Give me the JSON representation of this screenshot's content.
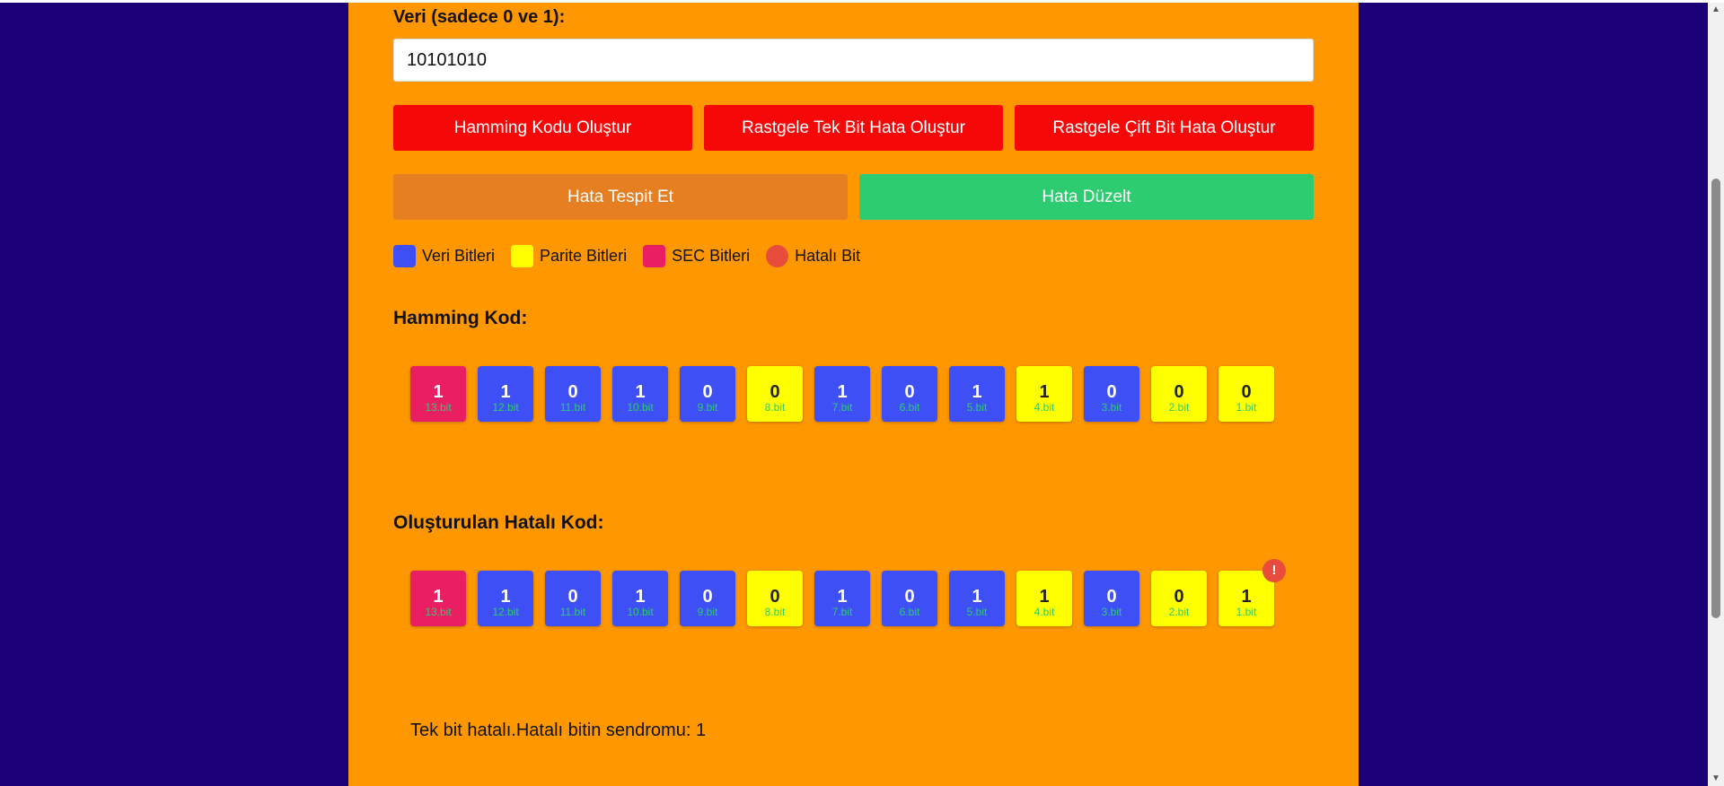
{
  "form": {
    "label": "Veri (sadece 0 ve 1):",
    "input_value": "10101010"
  },
  "buttons": {
    "generate": "Hamming Kodu Oluştur",
    "single_error": "Rastgele Tek Bit Hata Oluştur",
    "double_error": "Rastgele Çift Bit Hata Oluştur",
    "detect": "Hata Tespit Et",
    "correct": "Hata Düzelt"
  },
  "legend": {
    "data_bits": "Veri Bitleri",
    "parity_bits": "Parite Bitleri",
    "sec_bits": "SEC Bitleri",
    "error_bit": "Hatalı Bit"
  },
  "colors": {
    "data": "#3d4ff5",
    "parity": "#ffff00",
    "sec": "#e91e63",
    "error": "#e74c3c",
    "position_text": "#2ecc71",
    "panel": "#ff9800",
    "background": "#1b0078",
    "button_red": "#f60808",
    "button_orange": "#e67e22",
    "button_green": "#2ecc71"
  },
  "hamming": {
    "title": "Hamming Kod:",
    "bits": [
      {
        "value": "1",
        "pos": "13.bit",
        "type": "sec"
      },
      {
        "value": "1",
        "pos": "12.bit",
        "type": "data"
      },
      {
        "value": "0",
        "pos": "11.bit",
        "type": "data"
      },
      {
        "value": "1",
        "pos": "10.bit",
        "type": "data"
      },
      {
        "value": "0",
        "pos": "9.bit",
        "type": "data"
      },
      {
        "value": "0",
        "pos": "8.bit",
        "type": "parity"
      },
      {
        "value": "1",
        "pos": "7.bit",
        "type": "data"
      },
      {
        "value": "0",
        "pos": "6.bit",
        "type": "data"
      },
      {
        "value": "1",
        "pos": "5.bit",
        "type": "data"
      },
      {
        "value": "1",
        "pos": "4.bit",
        "type": "parity"
      },
      {
        "value": "0",
        "pos": "3.bit",
        "type": "data"
      },
      {
        "value": "0",
        "pos": "2.bit",
        "type": "parity"
      },
      {
        "value": "0",
        "pos": "1.bit",
        "type": "parity"
      }
    ]
  },
  "error_code": {
    "title": "Oluşturulan Hatalı Kod:",
    "badge": "!",
    "bits": [
      {
        "value": "1",
        "pos": "13.bit",
        "type": "sec",
        "error": false
      },
      {
        "value": "1",
        "pos": "12.bit",
        "type": "data",
        "error": false
      },
      {
        "value": "0",
        "pos": "11.bit",
        "type": "data",
        "error": false
      },
      {
        "value": "1",
        "pos": "10.bit",
        "type": "data",
        "error": false
      },
      {
        "value": "0",
        "pos": "9.bit",
        "type": "data",
        "error": false
      },
      {
        "value": "0",
        "pos": "8.bit",
        "type": "parity",
        "error": false
      },
      {
        "value": "1",
        "pos": "7.bit",
        "type": "data",
        "error": false
      },
      {
        "value": "0",
        "pos": "6.bit",
        "type": "data",
        "error": false
      },
      {
        "value": "1",
        "pos": "5.bit",
        "type": "data",
        "error": false
      },
      {
        "value": "1",
        "pos": "4.bit",
        "type": "parity",
        "error": false
      },
      {
        "value": "0",
        "pos": "3.bit",
        "type": "data",
        "error": false
      },
      {
        "value": "0",
        "pos": "2.bit",
        "type": "parity",
        "error": false
      },
      {
        "value": "1",
        "pos": "1.bit",
        "type": "parity",
        "error": true
      }
    ]
  },
  "result": {
    "text": "Tek bit hatalı.Hatalı bitin sendromu: 1"
  },
  "scrollbar": {
    "up_icon": "triangle-up-icon",
    "down_icon": "triangle-down-icon"
  }
}
